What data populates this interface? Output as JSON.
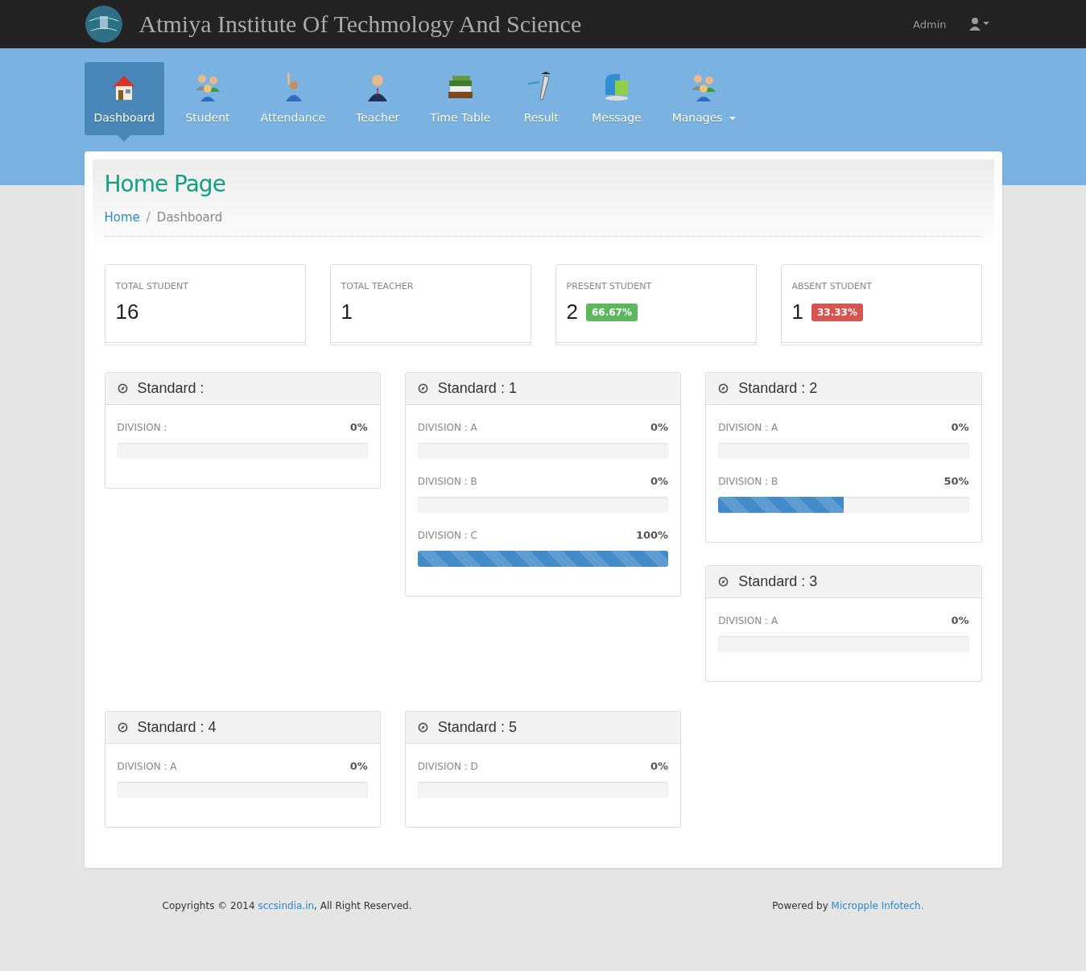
{
  "header": {
    "title": "Atmiya Institute Of Techmology And Science",
    "user": "Admin"
  },
  "nav": [
    {
      "label": "Dashboard",
      "selected": true,
      "dropdown": false
    },
    {
      "label": "Student",
      "selected": false,
      "dropdown": false
    },
    {
      "label": "Attendance",
      "selected": false,
      "dropdown": false
    },
    {
      "label": "Teacher",
      "selected": false,
      "dropdown": false
    },
    {
      "label": "Time Table",
      "selected": false,
      "dropdown": false
    },
    {
      "label": "Result",
      "selected": false,
      "dropdown": false
    },
    {
      "label": "Message",
      "selected": false,
      "dropdown": false
    },
    {
      "label": "Manages",
      "selected": false,
      "dropdown": true
    }
  ],
  "page": {
    "title": "Home Page",
    "breadcrumb": [
      {
        "label": "Home",
        "kind": "link"
      },
      {
        "label": "/",
        "kind": "separator"
      },
      {
        "label": "Dashboard",
        "kind": "current"
      }
    ]
  },
  "stats": [
    {
      "label": "TOTAL STUDENT",
      "value": "16"
    },
    {
      "label": "TOTAL TEACHER",
      "value": "1"
    },
    {
      "label": "PRESENT STUDENT",
      "value": "2",
      "badge": {
        "text": "66.67%",
        "color": "#5cb85c"
      }
    },
    {
      "label": "ABSENT STUDENT",
      "value": "1",
      "badge": {
        "text": "33.33%",
        "color": "#d9534f"
      }
    }
  ],
  "standard_rows": [
    {
      "columns": [
        {
          "panels": [
            {
              "title": "Standard :",
              "divisions": [
                {
                  "label": "DIVISION :",
                  "percent": "0%",
                  "level": 0
                }
              ]
            }
          ]
        },
        {
          "panels": [
            {
              "title": "Standard : 1",
              "divisions": [
                {
                  "label": "DIVISION : A",
                  "percent": "0%",
                  "level": 0
                },
                {
                  "label": "DIVISION : B",
                  "percent": "0%",
                  "level": 0
                },
                {
                  "label": "DIVISION : C",
                  "percent": "100%",
                  "level": 1
                }
              ]
            }
          ]
        },
        {
          "panels": [
            {
              "title": "Standard : 2",
              "divisions": [
                {
                  "label": "DIVISION : A",
                  "percent": "0%",
                  "level": 0
                },
                {
                  "label": "DIVISION : B",
                  "percent": "50%",
                  "level": 0.5
                }
              ]
            },
            {
              "title": "Standard : 3",
              "divisions": [
                {
                  "label": "DIVISION : A",
                  "percent": "0%",
                  "level": 0
                }
              ]
            }
          ]
        }
      ]
    },
    {
      "columns": [
        {
          "panels": [
            {
              "title": "Standard : 4",
              "divisions": [
                {
                  "label": "DIVISION : A",
                  "percent": "0%",
                  "level": 0
                }
              ]
            }
          ]
        },
        {
          "panels": [
            {
              "title": "Standard : 5",
              "divisions": [
                {
                  "label": "DIVISION : D",
                  "percent": "0%",
                  "level": 0
                }
              ]
            }
          ]
        }
      ]
    }
  ],
  "footer": {
    "left": [
      {
        "text": "Copyrights © 2014 ",
        "kind": "text"
      },
      {
        "text": "sccsindia.in",
        "kind": "link"
      },
      {
        "text": ", All Right Reserved.",
        "kind": "text"
      }
    ],
    "right": [
      {
        "text": "Powered by ",
        "kind": "text"
      },
      {
        "text": "Micropple Infotech.",
        "kind": "link"
      }
    ]
  }
}
